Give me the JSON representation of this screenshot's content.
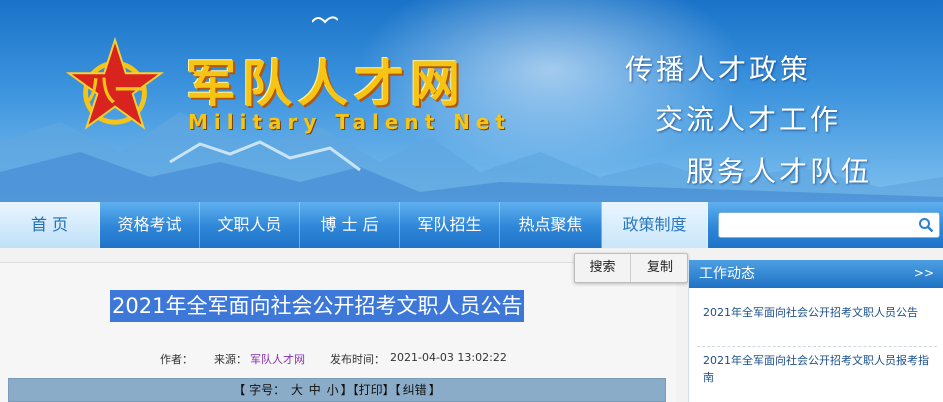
{
  "header": {
    "site_title": "军队人才网",
    "site_subtitle": "Military Talent Net",
    "slogans": [
      "传播人才政策",
      "交流人才工作",
      "服务人才队伍"
    ]
  },
  "nav": {
    "items": [
      {
        "label": "首 页"
      },
      {
        "label": "资格考试"
      },
      {
        "label": "文职人员"
      },
      {
        "label": "博 士 后"
      },
      {
        "label": "军队招生"
      },
      {
        "label": "热点聚焦"
      },
      {
        "label": "政策制度"
      }
    ],
    "search_value": ""
  },
  "popup": {
    "search_label": "搜索",
    "copy_label": "复制"
  },
  "article": {
    "title": "2021年全军面向社会公开招考文职人员公告",
    "author_label": "作者：",
    "source_label": "来源：",
    "source_value": "军队人才网",
    "time_label": "发布时间：",
    "time_value": "2021-04-03 13:02:22",
    "toolbar": {
      "font_label": "【 字号：",
      "size_large": "大",
      "size_medium": "中",
      "size_small": "小",
      "print_label": "】【打印】【",
      "error_label": "纠错",
      "close_bracket": "】"
    }
  },
  "sidebar": {
    "title": "工作动态",
    "more": ">>",
    "items": [
      {
        "label": "2021年全军面向社会公开招考文职人员公告"
      },
      {
        "label": "2021年全军面向社会公开招考文职人员报考指南"
      }
    ]
  },
  "colors": {
    "banner_blue": "#2e86d8",
    "title_gold": "#f5c414",
    "selection_blue": "#3d78d8",
    "source_purple": "#8a2fb0"
  }
}
